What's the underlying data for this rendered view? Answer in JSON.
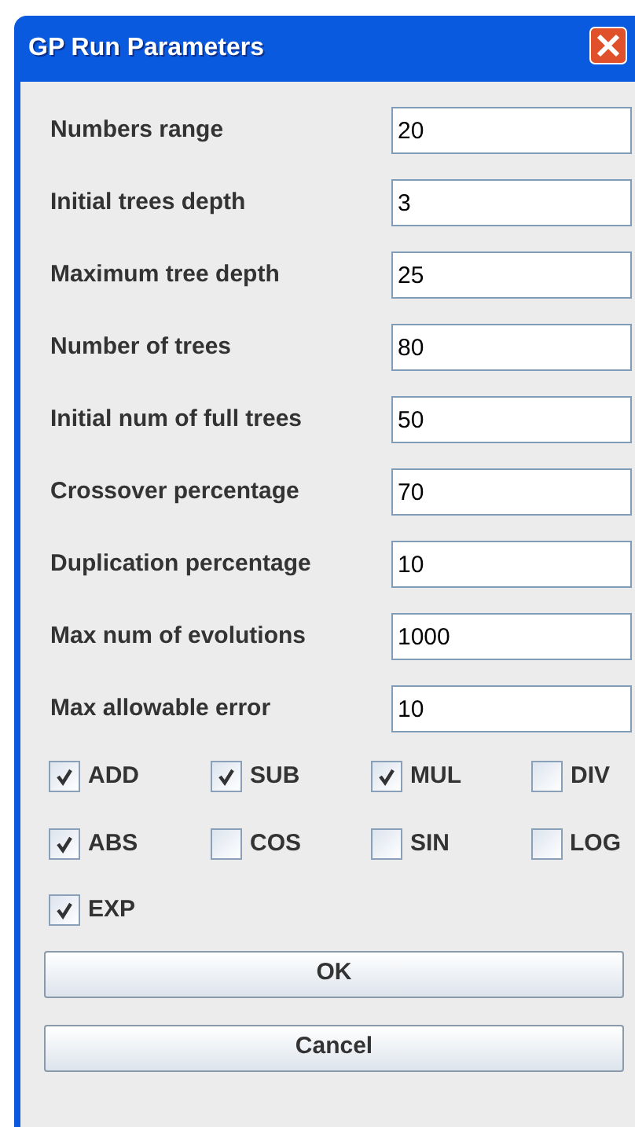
{
  "window": {
    "title": "GP Run Parameters"
  },
  "fields": [
    {
      "label": "Numbers range",
      "value": "20"
    },
    {
      "label": "Initial trees depth",
      "value": "3"
    },
    {
      "label": "Maximum tree depth",
      "value": "25"
    },
    {
      "label": "Number of trees",
      "value": "80"
    },
    {
      "label": "Initial num of full trees",
      "value": "50"
    },
    {
      "label": "Crossover percentage",
      "value": "70"
    },
    {
      "label": "Duplication percentage",
      "value": "10"
    },
    {
      "label": "Max num of evolutions",
      "value": "1000"
    },
    {
      "label": "Max allowable error",
      "value": "10"
    }
  ],
  "functions": [
    {
      "label": "ADD",
      "checked": true
    },
    {
      "label": "SUB",
      "checked": true
    },
    {
      "label": "MUL",
      "checked": true
    },
    {
      "label": "DIV",
      "checked": false
    },
    {
      "label": "ABS",
      "checked": true
    },
    {
      "label": "COS",
      "checked": false
    },
    {
      "label": "SIN",
      "checked": false
    },
    {
      "label": "LOG",
      "checked": false
    },
    {
      "label": "EXP",
      "checked": true
    }
  ],
  "buttons": [
    "OK",
    "Cancel"
  ]
}
